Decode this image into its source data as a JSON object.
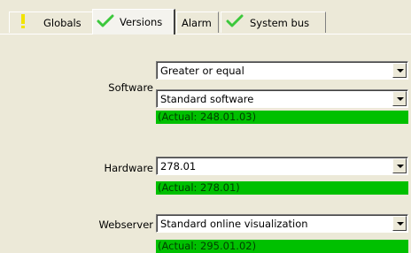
{
  "tabs": [
    {
      "label": "Globals",
      "icon": "warning-icon",
      "icon_color": "#f2e300"
    },
    {
      "label": "Versions",
      "icon": "checkmark-icon",
      "icon_color": "#3cc83c"
    },
    {
      "label": "Alarm"
    },
    {
      "label": "System bus",
      "icon": "checkmark-icon",
      "icon_color": "#3cc83c"
    }
  ],
  "software": {
    "label": "Software",
    "condition": "Greater or equal",
    "version": "Standard software",
    "actual": "(Actual: 248.01.03)"
  },
  "hardware": {
    "label": "Hardware",
    "value": "278.01",
    "actual": "(Actual: 278.01)"
  },
  "webserver": {
    "label": "Webserver",
    "value": "Standard online visualization",
    "actual": "(Actual: 295.01.02)"
  },
  "colors": {
    "status_ok": "#00c000"
  }
}
